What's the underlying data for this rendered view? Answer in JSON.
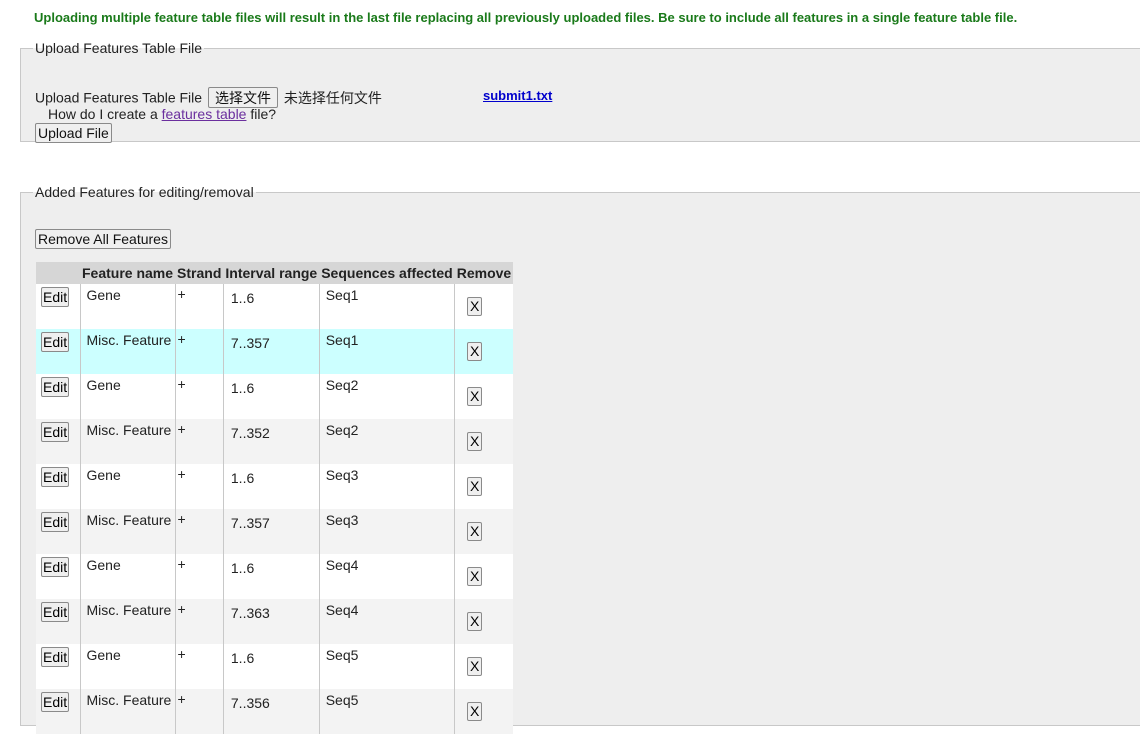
{
  "warning_text": "Uploading multiple feature table files will result in the last file replacing all previously uploaded files. Be sure to include all features in a single feature table file.",
  "upload": {
    "legend": "Upload Features Table File",
    "field_label": "Upload Features Table File",
    "choose_file_button": "选择文件",
    "no_file_text": "未选择任何文件",
    "uploaded_file_link": "submit1.txt",
    "howto_prefix": "How do I create a",
    "howto_link": "features table",
    "howto_suffix": "file?",
    "upload_button": "Upload File"
  },
  "features": {
    "legend": "Added Features for editing/removal",
    "remove_all_button": "Remove All Features",
    "headers": [
      "",
      "Feature name",
      "Strand",
      "Interval range",
      "Sequences affected",
      "Remove"
    ],
    "edit_label": "Edit",
    "remove_label": "X",
    "rows": [
      {
        "name": "Gene",
        "strand": "+",
        "interval": "1..6",
        "sequence": "Seq1"
      },
      {
        "name": "Misc. Feature",
        "strand": "+",
        "interval": "7..357",
        "sequence": "Seq1",
        "highlighted": true
      },
      {
        "name": "Gene",
        "strand": "+",
        "interval": "1..6",
        "sequence": "Seq2"
      },
      {
        "name": "Misc. Feature",
        "strand": "+",
        "interval": "7..352",
        "sequence": "Seq2"
      },
      {
        "name": "Gene",
        "strand": "+",
        "interval": "1..6",
        "sequence": "Seq3"
      },
      {
        "name": "Misc. Feature",
        "strand": "+",
        "interval": "7..357",
        "sequence": "Seq3"
      },
      {
        "name": "Gene",
        "strand": "+",
        "interval": "1..6",
        "sequence": "Seq4"
      },
      {
        "name": "Misc. Feature",
        "strand": "+",
        "interval": "7..363",
        "sequence": "Seq4"
      },
      {
        "name": "Gene",
        "strand": "+",
        "interval": "1..6",
        "sequence": "Seq5"
      },
      {
        "name": "Misc. Feature",
        "strand": "+",
        "interval": "7..356",
        "sequence": "Seq5"
      }
    ]
  },
  "colors": {
    "warning": "#1a7a1a",
    "highlight_row": "#ccffff",
    "link": "#0000cc",
    "visited_link": "#6b2f9e"
  }
}
